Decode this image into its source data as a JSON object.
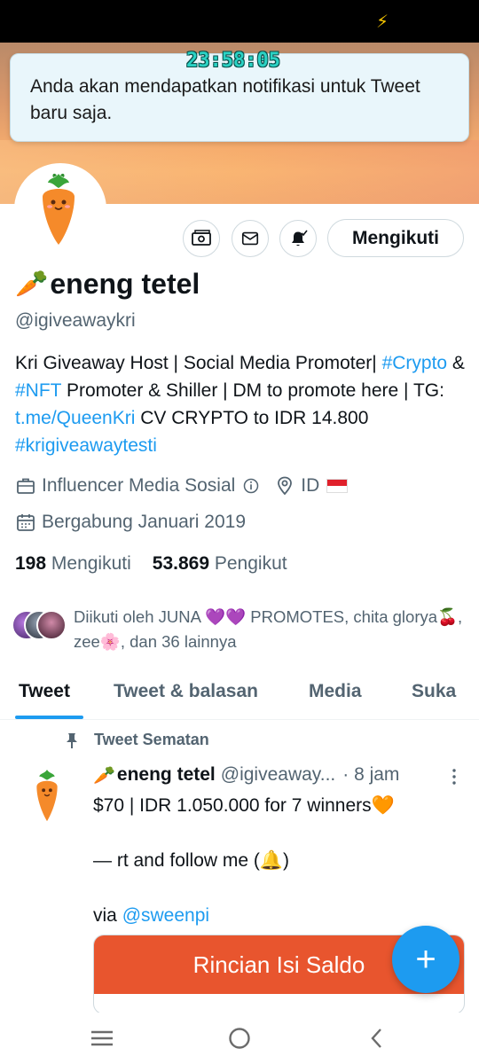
{
  "status_bar": {
    "time_overlay": "23:58:05",
    "indicator": "⚡"
  },
  "toast": {
    "message": "Anda akan mendapatkan notifikasi untuk Tweet baru saja."
  },
  "profile": {
    "display_name": "eneng tetel",
    "name_emoji": "🥕",
    "handle": "@igiveawaykri",
    "follow_button": "Mengikuti",
    "bio": {
      "t1": "Kri Giveaway Host | Social Media Promoter| ",
      "l1": "#Crypto",
      "t2": " & ",
      "l2": "#NFT",
      "t3": " Promoter & Shiller | DM to promote here | TG: ",
      "l3": "t.me/QueenKri",
      "t4": " CV CRYPTO to IDR 14.800 ",
      "l4": "#krigiveawaytesti"
    },
    "category": "Influencer Media Sosial",
    "location": "ID",
    "joined": "Bergabung Januari 2019",
    "following_count": "198",
    "following_label": "Mengikuti",
    "followers_count": "53.869",
    "followers_label": "Pengikut",
    "followed_by": "Diikuti oleh JUNA 💜💜 PROMOTES, chita glorya🍒, zee🌸, dan 36 lainnya"
  },
  "tabs": [
    {
      "label": "Tweet"
    },
    {
      "label": "Tweet & balasan"
    },
    {
      "label": "Media"
    },
    {
      "label": "Suka"
    }
  ],
  "pinned_tweet": {
    "pinned_label": "Tweet Sematan",
    "author_name": "eneng tetel",
    "author_emoji": "🥕",
    "author_handle": "@igiveaway...",
    "time": "· 8 jam",
    "line1": "$70 | IDR 1.050.000 for 7 winners🧡",
    "line2": "— rt and follow me (🔔)",
    "line3_prefix": "via ",
    "line3_link": "@sweenpi",
    "card_title": "Rincian Isi Saldo"
  },
  "fab": {
    "label": "+"
  },
  "colors": {
    "accent": "#1d9bf0",
    "text": "#0f1419",
    "muted": "#536471",
    "card": "#e8552e"
  }
}
